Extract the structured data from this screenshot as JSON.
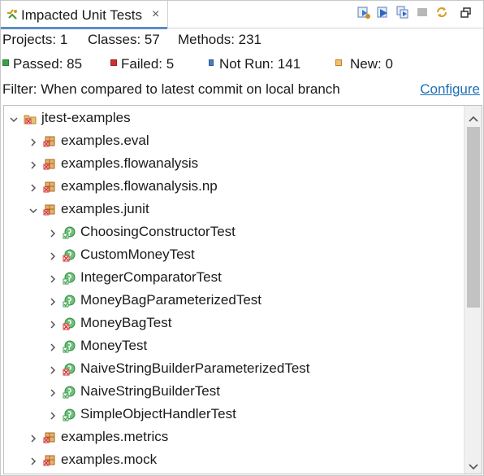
{
  "tab": {
    "title": "Impacted Unit Tests",
    "close_glyph": "×",
    "icon": "impacted-tests-icon"
  },
  "toolbar": {
    "buttons": [
      {
        "name": "run-tests-button",
        "icon": "run-icon"
      },
      {
        "name": "run-next-button",
        "icon": "run-next-icon"
      },
      {
        "name": "run-selected-button",
        "icon": "run-selected-icon"
      },
      {
        "name": "stop-button",
        "icon": "stop-icon"
      },
      {
        "name": "refresh-button",
        "icon": "refresh-icon"
      },
      {
        "name": "maximize-button",
        "icon": "maximize-icon"
      }
    ]
  },
  "summary": {
    "projects": "Projects: 1",
    "classes": "Classes: 57",
    "methods": "Methods: 231"
  },
  "status": {
    "passed": "Passed: 85",
    "failed": "Failed: 5",
    "not_run": "Not Run: 141",
    "new": "New: 0"
  },
  "colors": {
    "passed": "#3aa04a",
    "failed": "#d03030",
    "not_run": "#4a7cc0",
    "new": "#d08a20",
    "link": "#1f6fb5"
  },
  "filter": {
    "text": "Filter: When compared to latest commit on local branch",
    "configure_label": "Configure"
  },
  "tree": {
    "root": "jtest-examples",
    "items": [
      {
        "label": "jtest-examples",
        "level": "project",
        "expanded": true,
        "status": "failed"
      },
      {
        "label": "examples.eval",
        "level": "package",
        "expanded": false,
        "status": "mixed"
      },
      {
        "label": "examples.flowanalysis",
        "level": "package",
        "expanded": false,
        "status": "mixed"
      },
      {
        "label": "examples.flowanalysis.np",
        "level": "package",
        "expanded": false,
        "status": "mixed"
      },
      {
        "label": "examples.junit",
        "level": "package",
        "expanded": true,
        "status": "failed"
      },
      {
        "label": "ChoosingConstructorTest",
        "level": "class",
        "expanded": false,
        "status": "passed"
      },
      {
        "label": "CustomMoneyTest",
        "level": "class",
        "expanded": false,
        "status": "failed"
      },
      {
        "label": "IntegerComparatorTest",
        "level": "class",
        "expanded": false,
        "status": "passed"
      },
      {
        "label": "MoneyBagParameterizedTest",
        "level": "class",
        "expanded": false,
        "status": "passed"
      },
      {
        "label": "MoneyBagTest",
        "level": "class",
        "expanded": false,
        "status": "failed"
      },
      {
        "label": "MoneyTest",
        "level": "class",
        "expanded": false,
        "status": "passed"
      },
      {
        "label": "NaiveStringBuilderParameterizedTest",
        "level": "class",
        "expanded": false,
        "status": "failed"
      },
      {
        "label": "NaiveStringBuilderTest",
        "level": "class",
        "expanded": false,
        "status": "passed"
      },
      {
        "label": "SimpleObjectHandlerTest",
        "level": "class",
        "expanded": false,
        "status": "passed"
      },
      {
        "label": "examples.metrics",
        "level": "package",
        "expanded": false,
        "status": "mixed"
      },
      {
        "label": "examples.mock",
        "level": "package",
        "expanded": false,
        "status": "mixed"
      }
    ]
  }
}
